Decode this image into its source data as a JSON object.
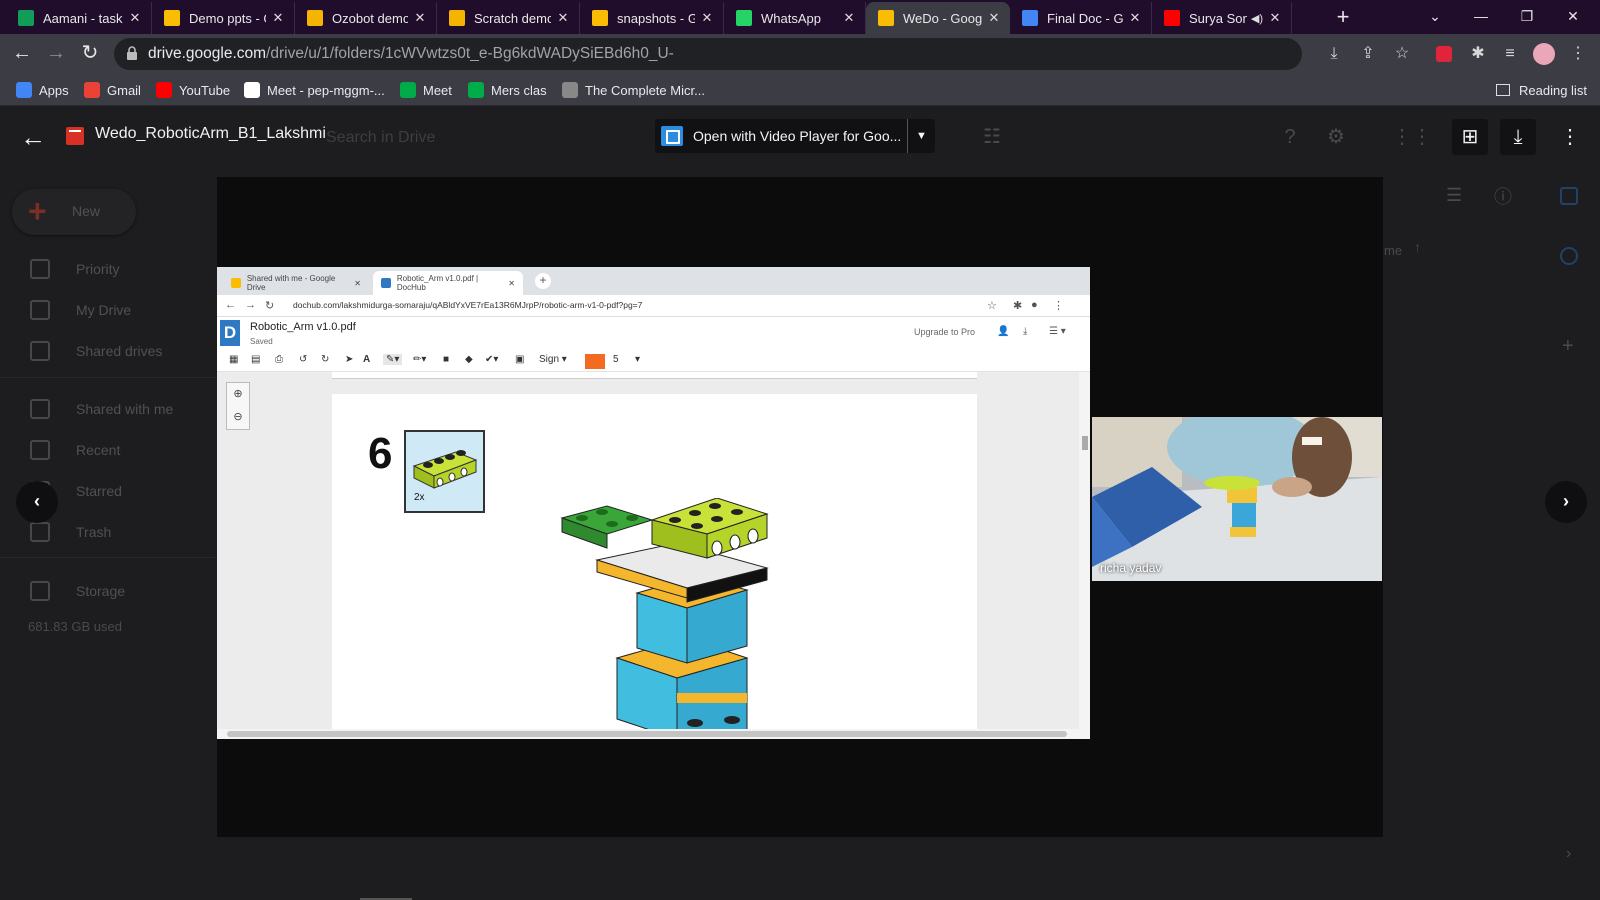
{
  "tabs": [
    {
      "title": "Aamani - task",
      "icon": "sheets-icon",
      "color": "#0f9d58"
    },
    {
      "title": "Demo ppts - G",
      "icon": "drive-icon",
      "color": "#fbbc04"
    },
    {
      "title": "Ozobot demo",
      "icon": "slides-icon",
      "color": "#f4b400"
    },
    {
      "title": "Scratch demo",
      "icon": "slides-icon",
      "color": "#f4b400"
    },
    {
      "title": "snapshots - Go",
      "icon": "drive-icon",
      "color": "#fbbc04"
    },
    {
      "title": "WhatsApp",
      "icon": "whatsapp-icon",
      "color": "#25d366"
    },
    {
      "title": "WeDo - Googl",
      "icon": "drive-icon",
      "color": "#fbbc04",
      "active": true
    },
    {
      "title": "Final Doc - Go",
      "icon": "docs-icon",
      "color": "#4285f4"
    },
    {
      "title": "Surya Son",
      "icon": "youtube-icon",
      "color": "#ff0000",
      "audio": true
    }
  ],
  "address": {
    "host": "drive.google.com",
    "path": "/drive/u/1/folders/1cWVwtzs0t_e-Bg6kdWADySiEBd6h0_U-"
  },
  "bookmarks": [
    {
      "label": "Apps",
      "icon": "apps-grid-icon",
      "color": "#4285f4"
    },
    {
      "label": "Gmail",
      "icon": "gmail-icon",
      "color": "#ea4335"
    },
    {
      "label": "YouTube",
      "icon": "youtube-icon",
      "color": "#ff0000"
    },
    {
      "label": "Meet - pep-mggm-...",
      "icon": "google-icon",
      "color": "#ffffff"
    },
    {
      "label": "Meet",
      "icon": "meet-icon",
      "color": "#00ac47"
    },
    {
      "label": "Mers clas",
      "icon": "meet-icon",
      "color": "#00ac47"
    },
    {
      "label": "The Complete Micr...",
      "icon": "course-icon",
      "color": "#888888"
    }
  ],
  "reading_list": "Reading list",
  "drive_background": {
    "new_label": "New",
    "sidebar": [
      "Priority",
      "My Drive",
      "Shared drives",
      "Shared with me",
      "Recent",
      "Starred",
      "Trash",
      "Storage"
    ],
    "storage_used": "681.83 GB used",
    "search_placeholder": "Search in Drive",
    "sort_label": "me"
  },
  "preview": {
    "file_name": "Wedo_RoboticArm_B1_Lakshmi",
    "open_with": "Open with Video Player for Goo..."
  },
  "shared_screen": {
    "inner_tabs": [
      "Shared with me - Google Drive",
      "Robotic_Arm v1.0.pdf | DocHub"
    ],
    "inner_url": "dochub.com/lakshmidurga-somaraju/qABldYxVE7rEa13R6MJrpP/robotic-arm-v1-0-pdf?pg=7",
    "doc_title": "Robotic_Arm v1.0.pdf",
    "doc_status": "Saved",
    "upgrade_label": "Upgrade to Pro",
    "sign_label": "Sign",
    "stroke_size": "5",
    "accent_color": "#f26b21",
    "step_number": "6",
    "part_count": "2x"
  },
  "webcam": {
    "participant": "richa yadav"
  }
}
